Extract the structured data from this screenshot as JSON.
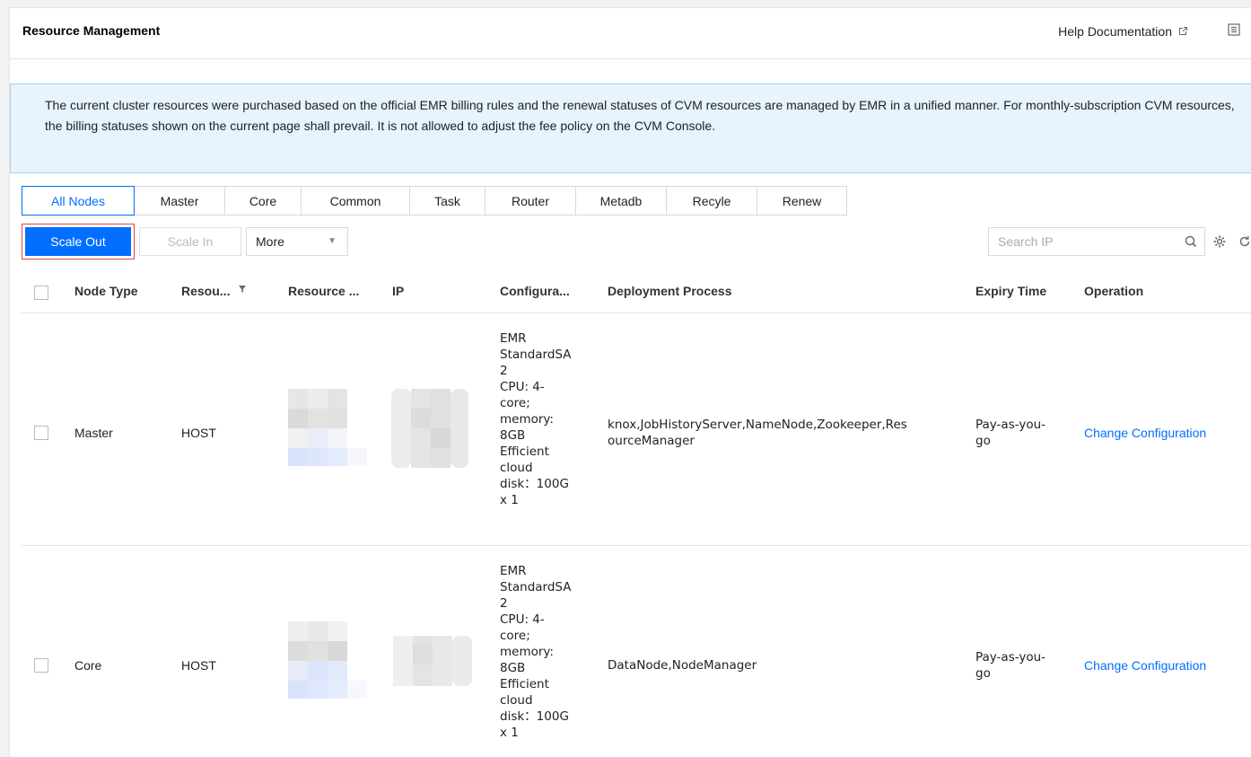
{
  "header": {
    "title": "Resource Management",
    "help_label": "Help Documentation"
  },
  "notice": {
    "text": "The current cluster resources were purchased based on the official EMR billing rules and the renewal statuses of CVM resources are managed by EMR in a unified manner. For monthly-subscription CVM resources, the billing statuses shown on the current page shall prevail. It is not allowed to adjust the fee policy on the CVM Console."
  },
  "tabs": [
    {
      "label": "All Nodes",
      "active": true
    },
    {
      "label": "Master"
    },
    {
      "label": "Core"
    },
    {
      "label": "Common"
    },
    {
      "label": "Task"
    },
    {
      "label": "Router"
    },
    {
      "label": "Metadb"
    },
    {
      "label": "Recyle"
    },
    {
      "label": "Renew"
    }
  ],
  "toolbar": {
    "scale_out": "Scale Out",
    "scale_in": "Scale In",
    "more": "More",
    "search_placeholder": "Search IP"
  },
  "table": {
    "columns": {
      "node_type": "Node Type",
      "resource_type": "Resou...",
      "resource_id": "Resource ...",
      "ip": "IP",
      "configuration": "Configura...",
      "deployment": "Deployment Process",
      "expiry": "Expiry Time",
      "operation": "Operation"
    },
    "rows": [
      {
        "node_type": "Master",
        "resource_type": "HOST",
        "config_lines": [
          "EMR",
          "StandardSA",
          "2",
          "CPU: 4-",
          "core;",
          "memory:",
          "8GB",
          "Efficient",
          "cloud",
          "disk：100G",
          "x 1"
        ],
        "deployment_line1": "knox,JobHistoryServer,NameNode,Zookeeper,Res",
        "deployment_line2": "ourceManager",
        "expiry_line1": "Pay-as-you-",
        "expiry_line2": "go",
        "operation": "Change Configuration"
      },
      {
        "node_type": "Core",
        "resource_type": "HOST",
        "config_lines": [
          "EMR",
          "StandardSA",
          "2",
          "CPU: 4-",
          "core;",
          "memory:",
          "8GB",
          "Efficient",
          "cloud",
          "disk：100G",
          "x 1"
        ],
        "deployment_line1": "DataNode,NodeManager",
        "deployment_line2": "",
        "expiry_line1": "Pay-as-you-",
        "expiry_line2": "go",
        "operation": "Change Configuration"
      }
    ]
  },
  "colors": {
    "primary": "#006eff",
    "notice_bg": "#e7f3fd",
    "notice_border": "#a9d2f4",
    "highlight_border": "#e54545"
  }
}
